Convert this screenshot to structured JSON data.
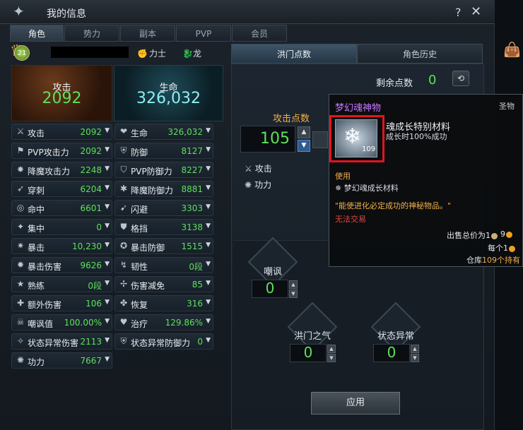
{
  "window": {
    "title": "我的信息",
    "help": "?",
    "close": "✕"
  },
  "tabs": [
    "角色",
    "势力",
    "副本",
    "PVP",
    "会员"
  ],
  "profile": {
    "level": "21",
    "class": "力士",
    "race": "龙"
  },
  "summary": {
    "attack_label": "攻击",
    "attack_value": "2092",
    "life_label": "生命",
    "life_value": "326,032"
  },
  "stats_left": [
    {
      "label": "攻击",
      "value": "2092",
      "icon": "sword-icon"
    },
    {
      "label": "PVP攻击力",
      "value": "2092",
      "icon": "pvp-attack-icon"
    },
    {
      "label": "降魔攻击力",
      "value": "2248",
      "icon": "demon-attack-icon"
    },
    {
      "label": "穿刺",
      "value": "6204",
      "icon": "pierce-icon"
    },
    {
      "label": "命中",
      "value": "6601",
      "icon": "hit-icon"
    },
    {
      "label": "集中",
      "value": "0",
      "icon": "focus-icon"
    },
    {
      "label": "暴击",
      "value": "10,230",
      "icon": "crit-icon"
    },
    {
      "label": "暴击伤害",
      "value": "9626",
      "icon": "crit-damage-icon"
    },
    {
      "label": "熟练",
      "value": "0段",
      "icon": "mastery-icon"
    },
    {
      "label": "额外伤害",
      "value": "106",
      "icon": "extra-damage-icon"
    },
    {
      "label": "嘲讽值",
      "value": "100.00%",
      "icon": "taunt-icon"
    },
    {
      "label": "状态异常伤害",
      "value": "2113",
      "icon": "status-damage-icon"
    },
    {
      "label": "功力",
      "value": "7667",
      "icon": "power-icon"
    }
  ],
  "stats_right": [
    {
      "label": "生命",
      "value": "326,032",
      "icon": "heart-icon"
    },
    {
      "label": "防御",
      "value": "8127",
      "icon": "shield-icon"
    },
    {
      "label": "PVP防御力",
      "value": "8227",
      "icon": "pvp-defense-icon"
    },
    {
      "label": "降魔防御力",
      "value": "8881",
      "icon": "demon-defense-icon"
    },
    {
      "label": "闪避",
      "value": "3303",
      "icon": "evade-icon"
    },
    {
      "label": "格挡",
      "value": "3138",
      "icon": "block-icon"
    },
    {
      "label": "暴击防御",
      "value": "1515",
      "icon": "crit-defense-icon"
    },
    {
      "label": "韧性",
      "value": "0段",
      "icon": "tenacity-icon"
    },
    {
      "label": "伤害减免",
      "value": "85",
      "icon": "damage-reduce-icon"
    },
    {
      "label": "恢复",
      "value": "316",
      "icon": "recovery-icon"
    },
    {
      "label": "治疗",
      "value": "129.86%",
      "icon": "heal-icon"
    },
    {
      "label": "状态异常防御力",
      "value": "0",
      "icon": "status-defense-icon"
    }
  ],
  "right_tabs": [
    "洪门点数",
    "角色历史"
  ],
  "points": {
    "remain_label": "剩余点数",
    "remain_value": "0",
    "attack_points_label": "攻击点数",
    "attack_points_value": "105",
    "sub_attack": "攻击",
    "sub_power": "功力"
  },
  "gems": [
    {
      "label": "嘲讽",
      "value": "0"
    },
    {
      "label": "洪门之气",
      "value": "0"
    },
    {
      "label": "状态异常",
      "value": "0"
    }
  ],
  "apply_label": "应用",
  "tooltip": {
    "title": "梦幻魂神物",
    "type": "圣物",
    "count": "109",
    "name": "魂成长特别材料",
    "desc": "成长时100%成功",
    "use_label": "使用",
    "use_item": "梦幻魂成长材料",
    "flavor": "\"能使进化必定成功的神秘物品。\"",
    "no_trade": "无法交易",
    "sell_label": "出售总价为1",
    "sell_value": "9",
    "per_label": "每个1",
    "stock_prefix": "仓库",
    "stock_num": "109",
    "stock_suffix": "个持有"
  }
}
